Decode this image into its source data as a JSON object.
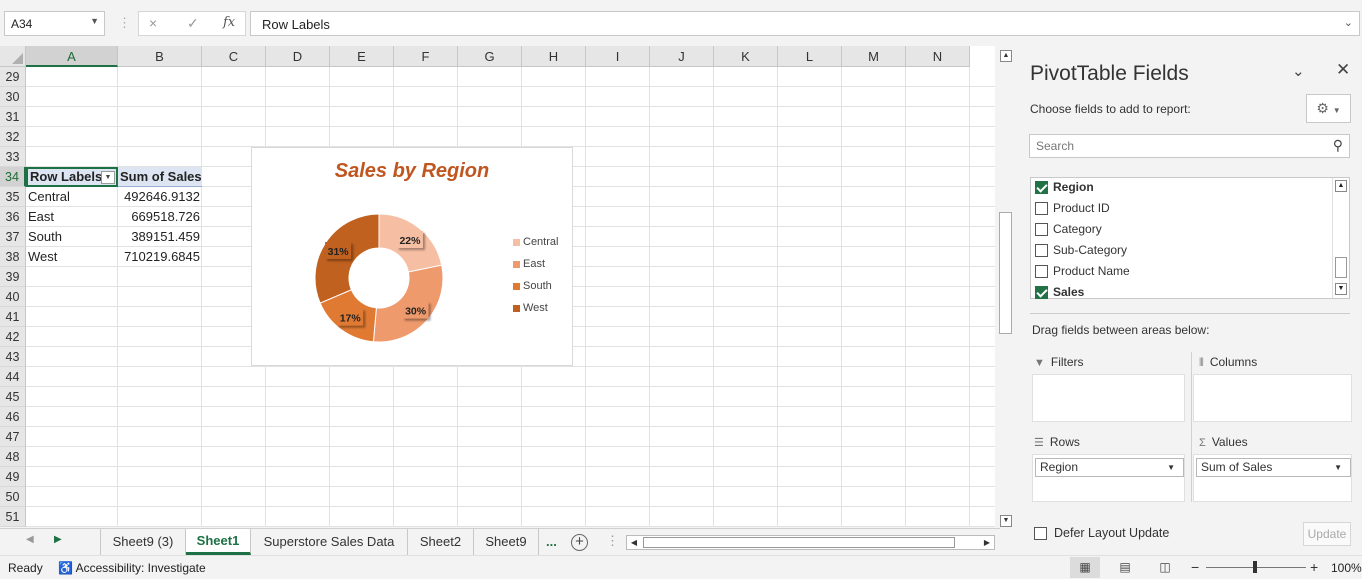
{
  "formula_bar": {
    "name_box": "A34",
    "cancel_icon": "×",
    "enter_icon": "✓",
    "fx_label": "fx",
    "content": "Row Labels"
  },
  "columns": [
    "A",
    "B",
    "C",
    "D",
    "E",
    "F",
    "G",
    "H",
    "I",
    "J",
    "K",
    "L",
    "M",
    "N"
  ],
  "rows": [
    "29",
    "30",
    "31",
    "32",
    "33",
    "34",
    "35",
    "36",
    "37",
    "38",
    "39",
    "40",
    "41",
    "42",
    "43",
    "44",
    "45",
    "46",
    "47",
    "48",
    "49",
    "50",
    "51"
  ],
  "pivot_table": {
    "header_label": "Row Labels",
    "header_value": "Sum of Sales",
    "rows": [
      {
        "label": "Central",
        "value": "492646.9132"
      },
      {
        "label": "East",
        "value": "669518.726"
      },
      {
        "label": "South",
        "value": "389151.459"
      },
      {
        "label": "West",
        "value": "710219.6845"
      }
    ]
  },
  "chart_data": {
    "type": "pie",
    "variant": "doughnut",
    "title": "Sales by Region",
    "categories": [
      "Central",
      "East",
      "South",
      "West"
    ],
    "values": [
      492646.9132,
      669518.726,
      389151.459,
      710219.6845
    ],
    "data_labels": [
      "22%",
      "30%",
      "17%",
      "31%"
    ],
    "colors": [
      "#f6bfa3",
      "#ee9a6d",
      "#e07a33",
      "#c0611f"
    ],
    "legend_position": "right"
  },
  "sheet_tabs": {
    "tabs": [
      "Sheet9 (3)",
      "Sheet1",
      "Superstore Sales Data",
      "Sheet2",
      "Sheet9"
    ],
    "active": "Sheet1",
    "more": "...",
    "add": "+"
  },
  "status_bar": {
    "ready": "Ready",
    "accessibility": "Accessibility: Investigate",
    "zoom": "100%"
  },
  "pivot_pane": {
    "title": "PivotTable Fields",
    "subtitle": "Choose fields to add to report:",
    "search_placeholder": "Search",
    "fields": [
      {
        "name": "Region",
        "checked": true
      },
      {
        "name": "Product ID",
        "checked": false
      },
      {
        "name": "Category",
        "checked": false
      },
      {
        "name": "Sub-Category",
        "checked": false
      },
      {
        "name": "Product Name",
        "checked": false
      },
      {
        "name": "Sales",
        "checked": true
      }
    ],
    "drag_label": "Drag fields between areas below:",
    "areas": {
      "filters": "Filters",
      "columns": "Columns",
      "rows": "Rows",
      "values": "Values",
      "rows_field": "Region",
      "values_field": "Sum of Sales"
    },
    "defer_label": "Defer Layout Update",
    "update_label": "Update"
  }
}
